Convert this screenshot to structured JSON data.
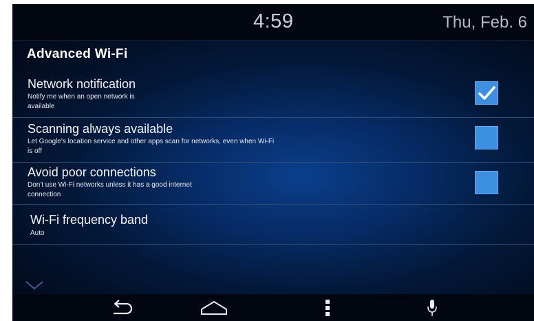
{
  "status": {
    "time": "4:59",
    "date": "Thu, Feb. 6"
  },
  "page": {
    "title": "Advanced  Wi-Fi"
  },
  "settings": [
    {
      "title": "Network notification",
      "subtitle": "Notify me when an open network is\navailable",
      "checked": true
    },
    {
      "title": "Scanning always available",
      "subtitle": "Let Google's location service and other apps scan for networks,  even when Wi-Fi\nis off",
      "checked": false
    },
    {
      "title": "Avoid poor connections",
      "subtitle": "Don't use Wi-Fi networks  unless it has a good internet\nconnection",
      "checked": false
    },
    {
      "title": "Wi-Fi frequency band",
      "subtitle": "Auto"
    }
  ],
  "icons": {
    "scroll": "chevron-down-icon",
    "back": "back-icon",
    "home": "home-icon",
    "menu": "overflow-menu-icon",
    "voice": "microphone-icon"
  },
  "colors": {
    "checkbox": "#3d8fe0",
    "background": "#062a63",
    "bars": "#010610"
  }
}
